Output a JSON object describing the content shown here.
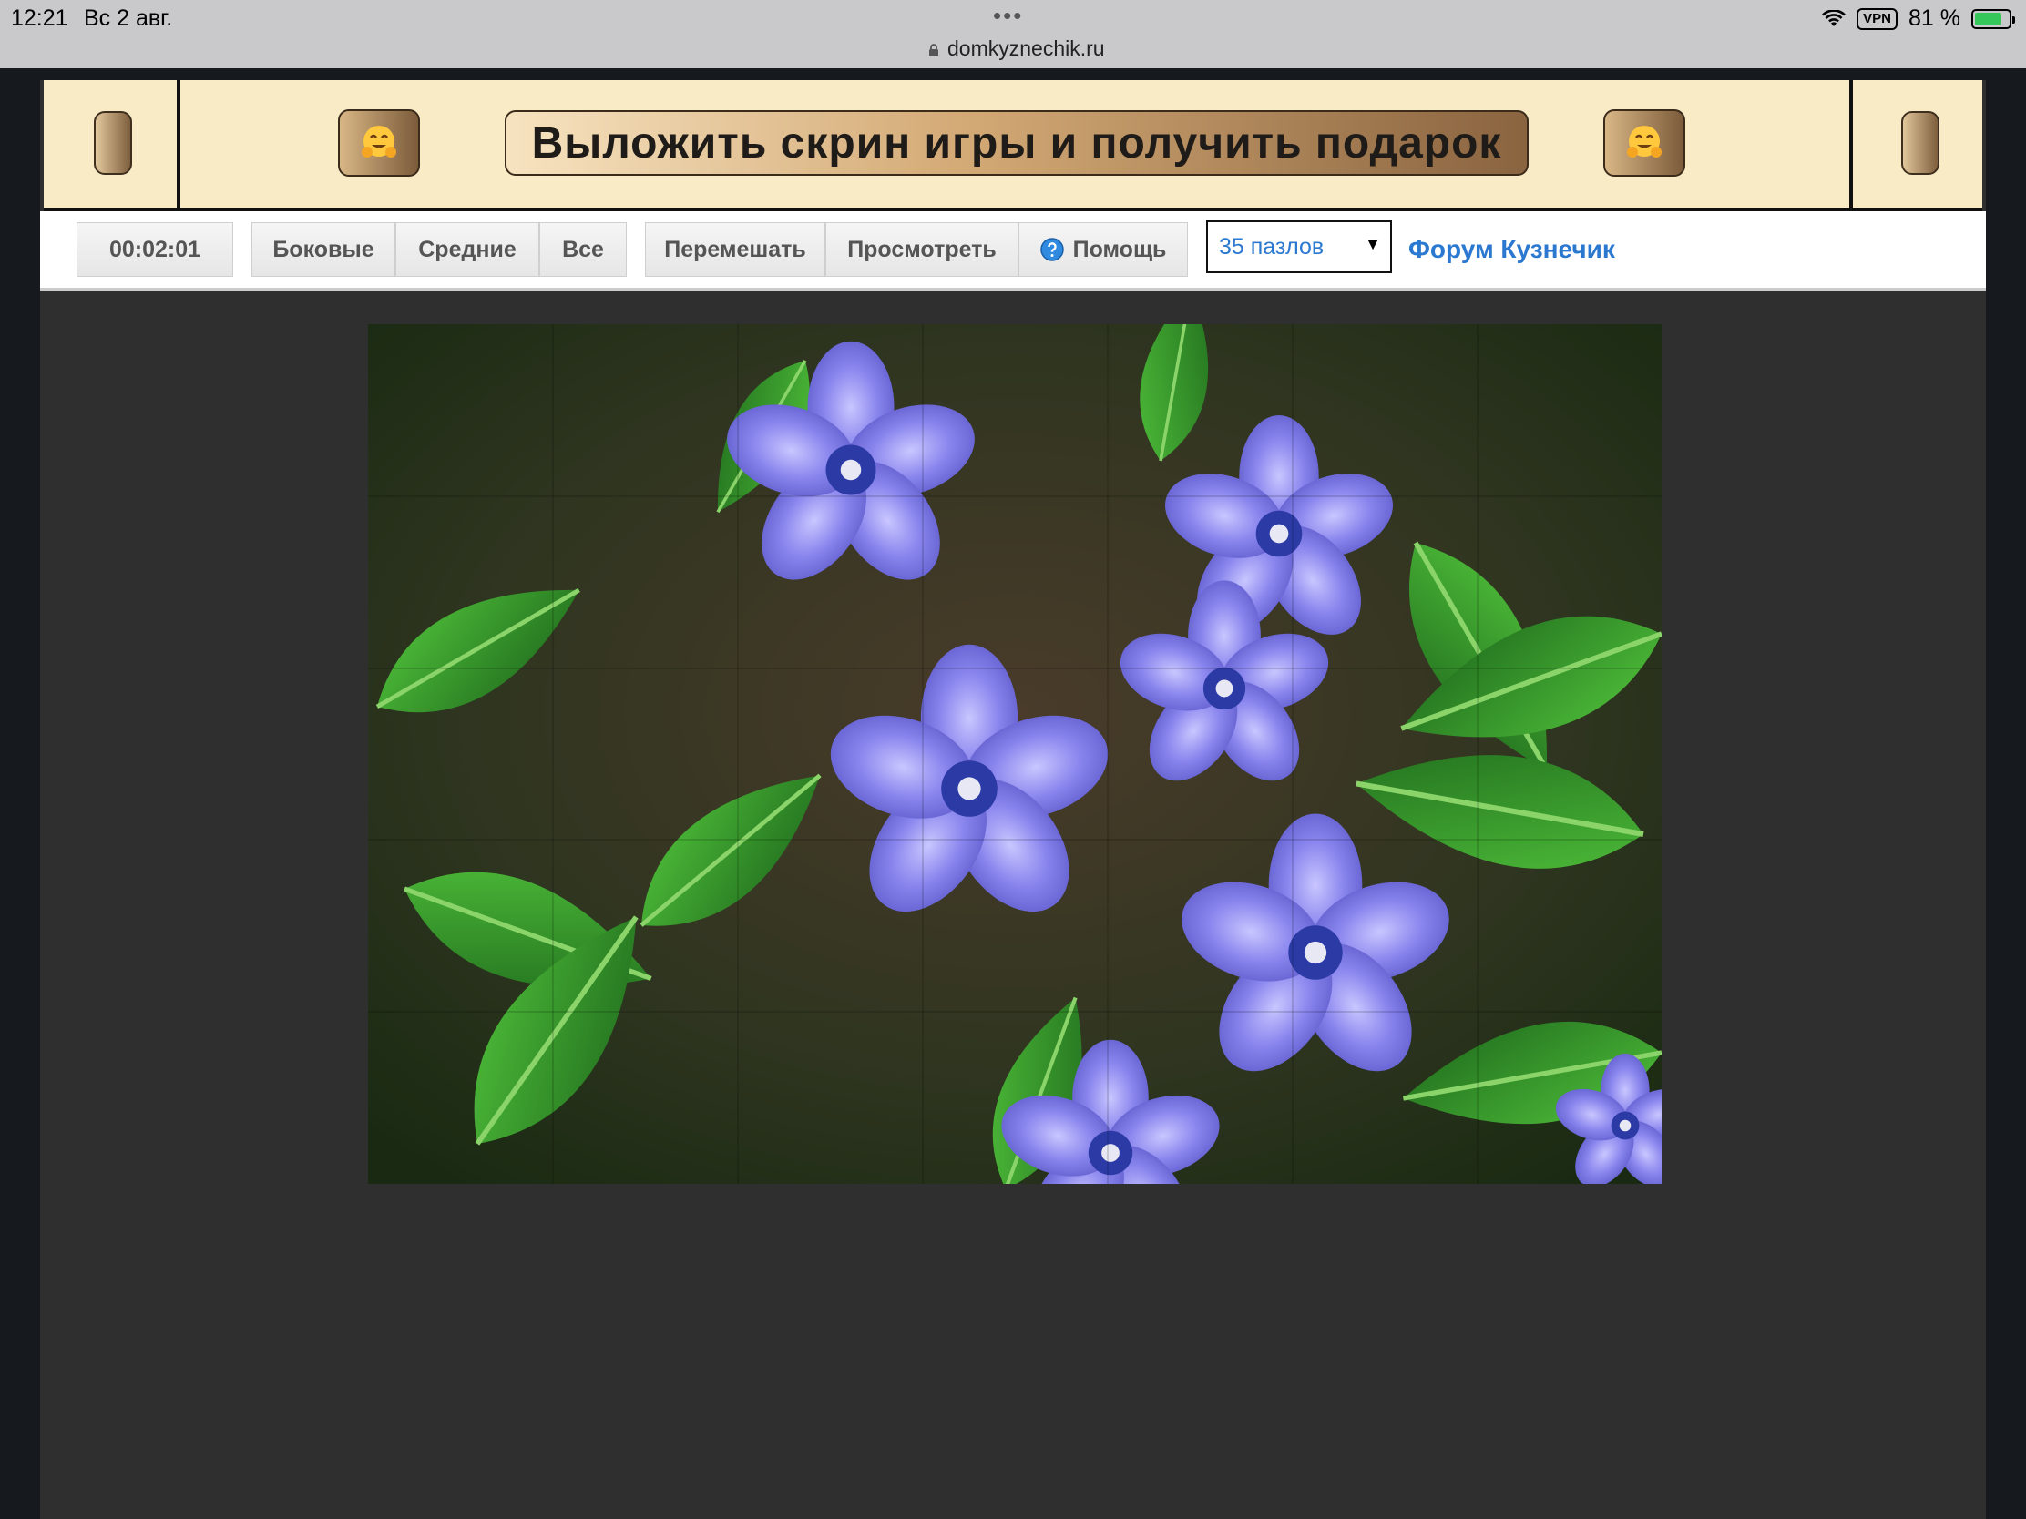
{
  "status_bar": {
    "time": "12:21",
    "date": "Вс 2 авг.",
    "url": "domkyznechik.ru",
    "vpn": "VPN",
    "battery": "81 %",
    "battery_level": 0.81
  },
  "banner": {
    "text": "Выложить скрин игры и получить подарок"
  },
  "toolbar": {
    "timer": "00:02:01",
    "btn_side": "Боковые",
    "btn_middle": "Средние",
    "btn_all": "Все",
    "btn_shuffle": "Перемешать",
    "btn_preview": "Просмотреть",
    "btn_help": "Помощь",
    "piece_count": "35 пазлов",
    "forum_link": "Форум Кузнечик"
  },
  "colors": {
    "banner_bg": "#f8ebc6",
    "link": "#2b78d0",
    "page_bg": "#2f2f2f"
  }
}
